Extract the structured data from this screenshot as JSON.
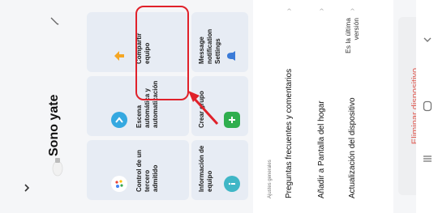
{
  "header": {
    "device_name": "Sono yate",
    "back_icon": "chevron-down-icon",
    "edit_icon": "pencil-icon",
    "device_image": "lamp-icon"
  },
  "tiles": {
    "info": {
      "label": "Información de equipo",
      "icon": "info-icon",
      "icon_color": "#3fb6c6"
    },
    "create_group": {
      "label": "Crear grupo",
      "icon": "add-group-icon",
      "icon_color": "#2fae4e"
    },
    "message": {
      "label": "Message notification Settings",
      "icon": "bell-icon",
      "icon_color": "#3b7bd8"
    },
    "third_party": {
      "label": "Control de un tercero admitido",
      "icon": "assistant-icon",
      "icon_color": "#f0b400"
    },
    "scene": {
      "label": "Escena automática y automatización",
      "icon": "automation-icon",
      "icon_color": "#35a8e0"
    },
    "share": {
      "label": "Compartir equipo",
      "icon": "share-icon",
      "icon_color": "#f5a623"
    }
  },
  "settings": {
    "heading": "Ajustes generales",
    "faq": "Preguntas frecuentes y comentarios",
    "home_screen": "Añadir a Pantalla del hogar",
    "update_label": "Actualización del dispositivo",
    "update_value": "Es la última versión"
  },
  "remove_button": "Eliminar dispositivo",
  "colors": {
    "annotation": "#e0212a",
    "danger_text": "#e05b52",
    "tile_bg": "#e7ecf4"
  }
}
